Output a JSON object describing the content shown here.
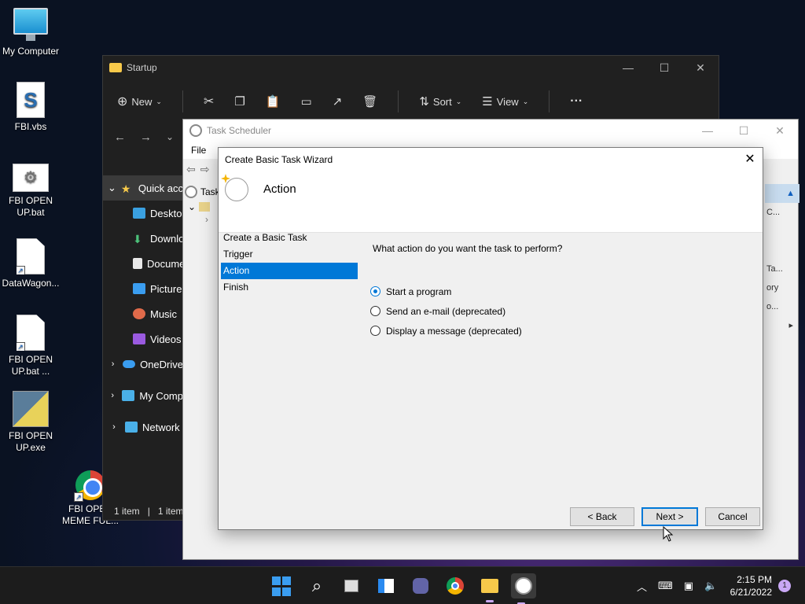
{
  "desktop": {
    "icons": [
      {
        "label": "My Computer"
      },
      {
        "label": "FBI.vbs"
      },
      {
        "label": "FBI OPEN UP.bat"
      },
      {
        "label": "DataWagon..."
      },
      {
        "label": "FBI OPEN UP.bat ..."
      },
      {
        "label": "FBI OPEN UP.exe"
      },
      {
        "label": "FBI OPEN MEME FUL..."
      }
    ]
  },
  "explorer": {
    "title": "Startup",
    "toolbar": {
      "new_label": "New",
      "sort_label": "Sort",
      "view_label": "View",
      "more_label": "···"
    },
    "sidebar": [
      {
        "label": "Quick acc"
      },
      {
        "label": "Desktop"
      },
      {
        "label": "Downlo"
      },
      {
        "label": "Docume"
      },
      {
        "label": "Pictures"
      },
      {
        "label": "Music"
      },
      {
        "label": "Videos"
      },
      {
        "label": "OneDrive"
      },
      {
        "label": "My Comp"
      },
      {
        "label": "Network"
      }
    ],
    "status": {
      "items": "1 item",
      "selected": "1 item"
    }
  },
  "task_scheduler": {
    "title": "Task Scheduler",
    "menu_file": "File",
    "tree_root": "Task",
    "right_pane": [
      "C...",
      "Ta...",
      "ory",
      "o..."
    ]
  },
  "wizard": {
    "title": "Create Basic Task Wizard",
    "header_title": "Action",
    "steps": [
      "Create a Basic Task",
      "Trigger",
      "Action",
      "Finish"
    ],
    "question": "What action do you want the task to perform?",
    "options": [
      {
        "label": "Start a program",
        "checked": true
      },
      {
        "label": "Send an e-mail (deprecated)",
        "checked": false
      },
      {
        "label": "Display a message (deprecated)",
        "checked": false
      }
    ],
    "buttons": {
      "back": "< Back",
      "next": "Next >",
      "cancel": "Cancel"
    }
  },
  "taskbar": {
    "time": "2:15 PM",
    "date": "6/21/2022",
    "notification_count": "1"
  }
}
